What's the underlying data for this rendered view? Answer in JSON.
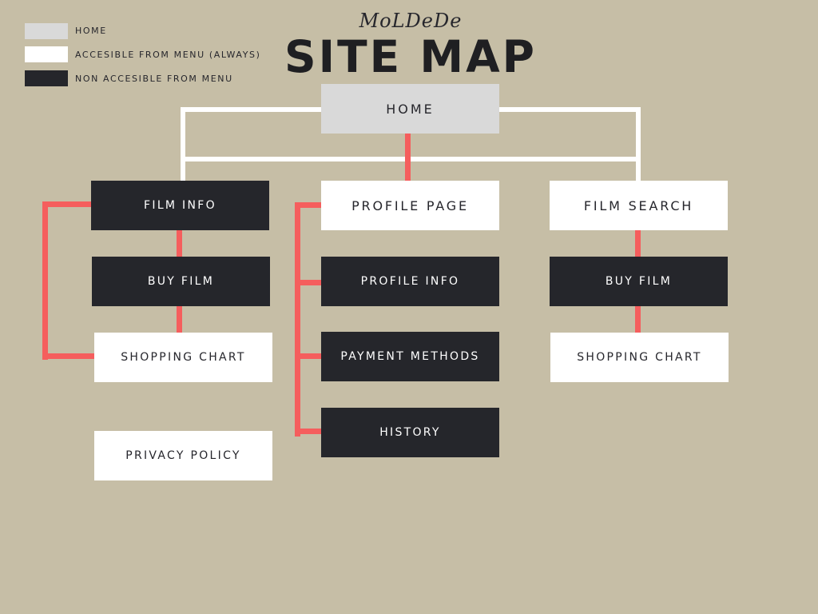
{
  "brand": "MoLDeDe",
  "title": "SITE MAP",
  "legend": {
    "home": {
      "label": "HOME",
      "color": "#d9d9d9"
    },
    "menu": {
      "label": "ACCESIBLE FROM MENU (ALWAYS)",
      "color": "#ffffff"
    },
    "nomenu": {
      "label": "NON ACCESIBLE FROM MENU",
      "color": "#25262b"
    }
  },
  "colors": {
    "background": "#c6bea6",
    "menu_connector": "#ffffff",
    "sub_connector": "#f55e5d"
  },
  "nodes": {
    "home": "HOME",
    "film_info": "FILM INFO",
    "buy_film_left": "BUY FILM",
    "shopping_chart_left": "SHOPPING CHART",
    "privacy_policy": "PRIVACY POLICY",
    "profile_page": "PROFILE PAGE",
    "profile_info": "PROFILE INFO",
    "payment_methods": "PAYMENT METHODS",
    "history": "HISTORY",
    "film_search": "FILM SEARCH",
    "buy_film_right": "BUY FILM",
    "shopping_chart_right": "SHOPPING CHART"
  }
}
